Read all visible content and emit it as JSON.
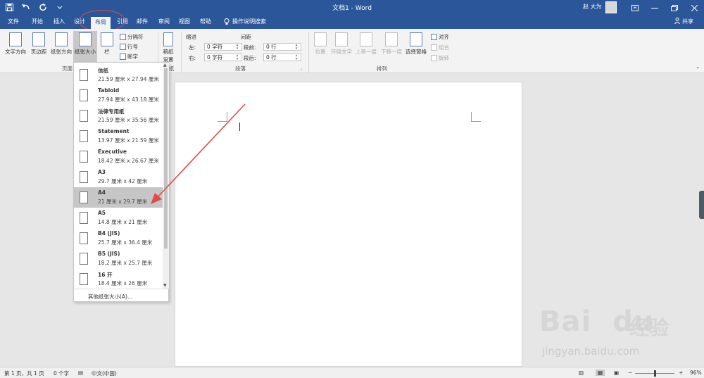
{
  "window": {
    "title": "文档1 - Word",
    "user": "赵 大为",
    "titlebar_color": "#2b579a"
  },
  "qat": [
    {
      "icon": "save-icon"
    },
    {
      "icon": "undo-icon"
    },
    {
      "icon": "redo-icon"
    },
    {
      "icon": "customize-qat-icon"
    }
  ],
  "tabs": {
    "file": "文件",
    "home": "开始",
    "insert": "插入",
    "design": "设计",
    "layout": "布局",
    "references": "引用",
    "mailings": "邮件",
    "review": "审阅",
    "view": "视图",
    "help": "帮助",
    "tellme": "操作说明搜索",
    "share": "共享"
  },
  "ribbon": {
    "page_setup": {
      "text_direction": "文字方向",
      "margins": "页边距",
      "orientation": "纸张方向",
      "size": "纸张大小",
      "columns": "栏",
      "breaks": "分隔符",
      "line_numbers": "行号",
      "hyphenation": "断字",
      "label": "页面"
    },
    "draft_paper": {
      "button": "稿纸",
      "button2": "设置",
      "label": "纸"
    },
    "paragraph": {
      "indent_heading": "缩进",
      "spacing_heading": "间距",
      "left_label": "左:",
      "left_value": "0 字符",
      "right_label": "右:",
      "right_value": "0 字符",
      "before_label": "段前:",
      "before_value": "0 行",
      "after_label": "段后:",
      "after_value": "0 行",
      "label": "段落"
    },
    "arrange": {
      "position": "位置",
      "wrap_text": "环绕文字",
      "bring_forward": "上移一层",
      "send_backward": "下移一层",
      "selection_pane": "选择窗格",
      "align": "对齐",
      "group": "组合",
      "rotate": "旋转",
      "label": "排列"
    }
  },
  "paper_sizes": {
    "items": [
      {
        "name": "信纸",
        "size": "21.59 厘米 x 27.94 厘米"
      },
      {
        "name": "Tabloid",
        "size": "27.94 厘米 x 43.18 厘米"
      },
      {
        "name": "法律专用纸",
        "size": "21.59 厘米 x 35.56 厘米"
      },
      {
        "name": "Statement",
        "size": "13.97 厘米 x 21.59 厘米"
      },
      {
        "name": "Executive",
        "size": "18.42 厘米 x 26.67 厘米"
      },
      {
        "name": "A3",
        "size": "29.7 厘米 x 42 厘米"
      },
      {
        "name": "A4",
        "size": "21 厘米 x 29.7 厘米"
      },
      {
        "name": "A5",
        "size": "14.8 厘米 x 21 厘米"
      },
      {
        "name": "B4 (JIS)",
        "size": "25.7 厘米 x 36.4 厘米"
      },
      {
        "name": "B5 (JIS)",
        "size": "18.2 厘米 x 25.7 厘米"
      },
      {
        "name": "16 开",
        "size": "18.4 厘米 x 26 厘米"
      }
    ],
    "selected": "A4",
    "more": "其他纸张大小(A)..."
  },
  "status": {
    "page": "第 1 页，共 1 页",
    "words": "0 个字",
    "language": "中文(中国)",
    "zoom": "96%",
    "zoom_minus": "−",
    "zoom_plus": "+"
  },
  "watermark": {
    "brand": "Bai",
    "brand2": "du",
    "brand_cn": "经验",
    "url": "jingyan.baidu.com"
  },
  "colors": {
    "accent": "#2b579a",
    "annotation": "#e24a4a",
    "highlight": "#c6c6c6"
  }
}
